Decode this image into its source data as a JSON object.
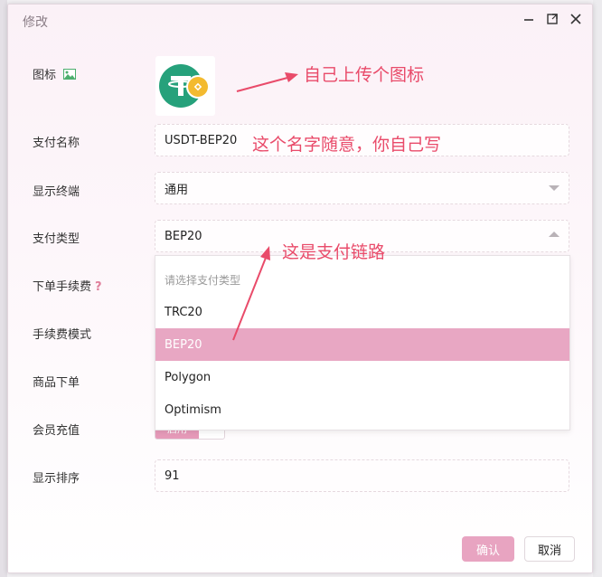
{
  "dialog": {
    "title": "修改",
    "controls": [
      "minimize-icon",
      "maximize-icon",
      "close-icon"
    ]
  },
  "form": {
    "icon_label": "图标",
    "pay_name_label": "支付名称",
    "pay_name_value": "USDT-BEP20",
    "display_terminal_label": "显示终端",
    "display_terminal_value": "通用",
    "pay_type_label": "支付类型",
    "pay_type_value": "BEP20",
    "order_fee_label": "下单手续费",
    "fee_mode_label": "手续费模式",
    "product_order_label": "商品下单",
    "member_recharge_label": "会员充值",
    "sort_label": "显示排序",
    "sort_value": "91",
    "toggle_on_label": "启用"
  },
  "dropdown": {
    "placeholder": "请选择支付类型",
    "options": [
      "TRC20",
      "BEP20",
      "Polygon",
      "Optimism"
    ],
    "selected": "BEP20"
  },
  "annotations": {
    "upload_icon": "自己上传个图标",
    "name_hint": "这个名字随意，你自己写",
    "chain_hint": "这是支付链路"
  },
  "buttons": {
    "confirm": "确认",
    "cancel": "取消"
  },
  "colors": {
    "accent": "#e8a4c1",
    "annotation": "#e94b6a",
    "tether_green": "#26a17b",
    "bnb_yellow": "#f3ba2f"
  }
}
